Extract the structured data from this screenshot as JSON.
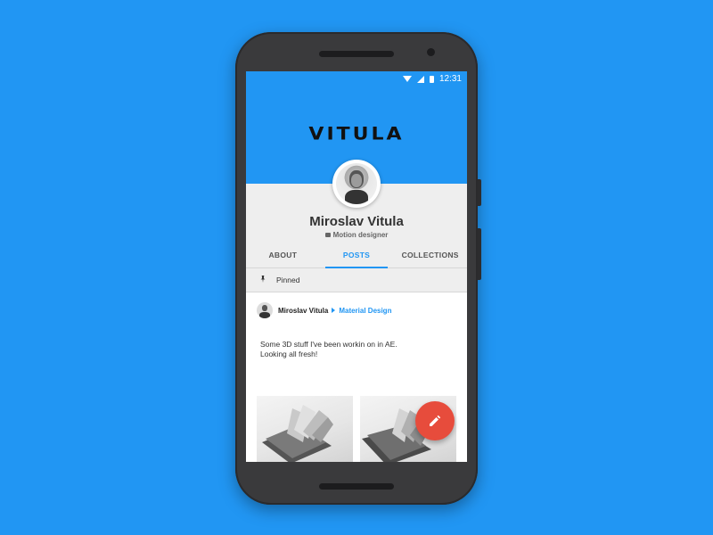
{
  "status_bar": {
    "time": "12:31",
    "icons": [
      "wifi-icon",
      "signal-icon",
      "battery-icon"
    ]
  },
  "header": {
    "logo_text": "VITULA",
    "background": "#2196f3"
  },
  "profile": {
    "name": "Miroslav Vitula",
    "role": "Motion designer",
    "role_icon": "briefcase-icon"
  },
  "tabs": [
    {
      "label": "ABOUT",
      "active": false
    },
    {
      "label": "POSTS",
      "active": true
    },
    {
      "label": "COLLECTIONS",
      "active": false
    }
  ],
  "pinned": {
    "label": "Pinned",
    "icon": "pin-icon"
  },
  "post": {
    "author": "Miroslav Vitula",
    "collection": "Material Design",
    "text_line1": "Some 3D stuff I've been workin on in AE.",
    "text_line2": "Looking all fresh!",
    "images": [
      "book-render-image-1",
      "book-render-image-2"
    ]
  },
  "fab": {
    "icon": "pencil-icon",
    "color": "#e74c3c"
  },
  "colors": {
    "accent": "#2196f3",
    "fab": "#e74c3c",
    "background": "#2196f3"
  }
}
